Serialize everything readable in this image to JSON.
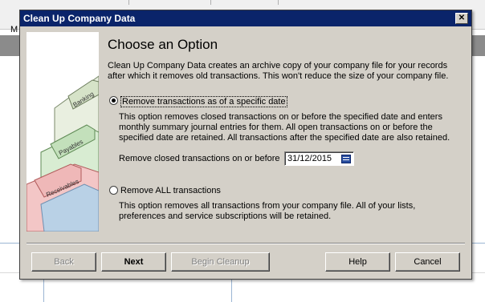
{
  "background": {
    "menubar_text": "M"
  },
  "dialog": {
    "title": "Clean Up Company Data",
    "heading": "Choose an Option",
    "intro": "Clean Up Company Data creates an archive copy of your company file for your records after which it removes old transactions. This won't reduce the size of your company file.",
    "option1": {
      "label": "Remove transactions as of a specific date",
      "selected": true,
      "description": "This option removes closed transactions on or before the specified date and enters monthly summary journal entries for them.  All open transactions on or before the specified date are retained.  All transactions after the specified date are also retained.",
      "date_label": "Remove closed transactions on or before",
      "date_value": "31/12/2015"
    },
    "option2": {
      "label": "Remove ALL transactions",
      "selected": false,
      "description": "This option removes all transactions from your company file.  All of your lists, preferences and service subscriptions will be retained."
    },
    "art_labels": {
      "tab1": "Banking",
      "tab2": "Payables",
      "tab3": "Receivables"
    },
    "buttons": {
      "back": "Back",
      "next": "Next",
      "begin_cleanup": "Begin Cleanup",
      "help": "Help",
      "cancel": "Cancel"
    },
    "colors": {
      "titlebar": "#0a246a",
      "face": "#d4d0c8"
    }
  }
}
